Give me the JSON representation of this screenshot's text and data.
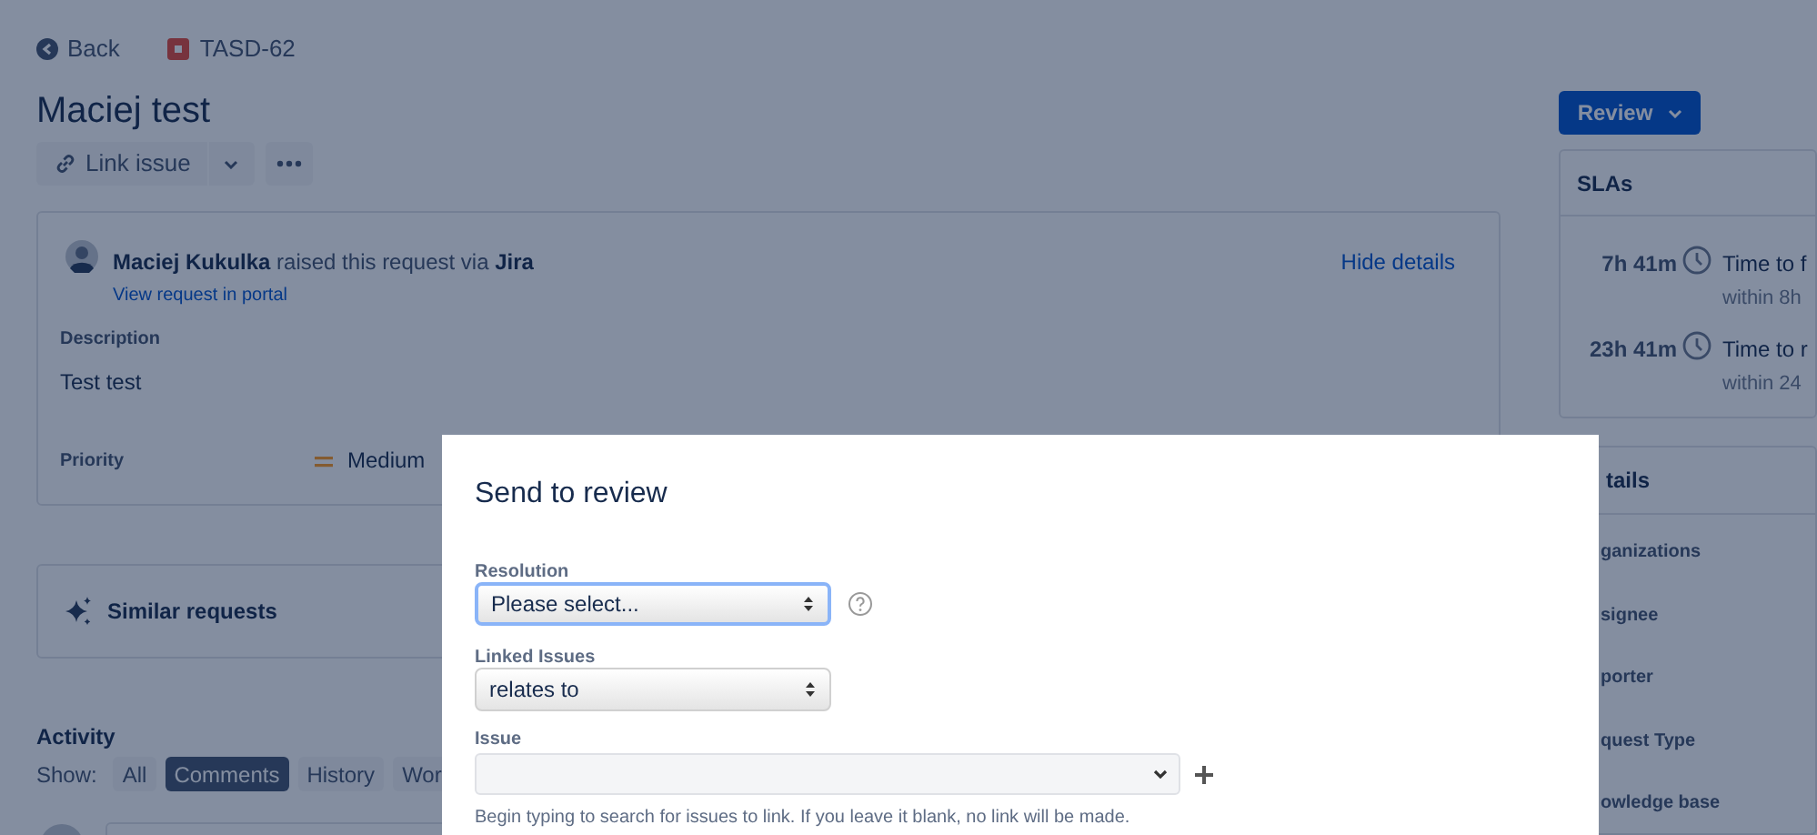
{
  "header": {
    "back": "Back",
    "issue_key": "TASD-62"
  },
  "title": "Maciej test",
  "toolbar": {
    "link_issue": "Link issue"
  },
  "request": {
    "raised": "**Maciej Kukulka** raised this request via **Jira**",
    "portal_link": "View request in portal",
    "hide_details": "Hide details",
    "fields": [
      {
        "label": "Description",
        "value": "Test test",
        "kind": "text"
      },
      {
        "label": "Priority",
        "value": "Medium",
        "kind": "priority"
      }
    ]
  },
  "similar": "Similar requests",
  "activity": {
    "title": "Activity",
    "show_label": "Show:",
    "filters": [
      {
        "label": "All",
        "selected": false
      },
      {
        "label": "Comments",
        "selected": true
      },
      {
        "label": "History",
        "selected": false
      },
      {
        "label": "Wor",
        "selected": false
      }
    ]
  },
  "review_button": "Review",
  "slas": {
    "title": "SLAs",
    "items": [
      {
        "time": "7h 41m",
        "name": "Time to f",
        "goal": "within 8h"
      },
      {
        "time": "23h 41m",
        "name": "Time to r",
        "goal": "within 24"
      }
    ]
  },
  "details": {
    "title": "tails",
    "fields": [
      "ganizations",
      "signee",
      "porter",
      "quest Type",
      "owledge base"
    ]
  },
  "dialog": {
    "title": "Send to review",
    "fields": [
      {
        "kind": "select",
        "label": "Resolution",
        "value": "Please select...",
        "focused": true,
        "help": true
      },
      {
        "kind": "select",
        "label": "Linked Issues",
        "value": "relates to",
        "focused": false,
        "help": false
      },
      {
        "kind": "picker",
        "label": "Issue",
        "hint": "Begin typing to search for issues to link. If you leave it blank, no link will be made."
      }
    ]
  }
}
